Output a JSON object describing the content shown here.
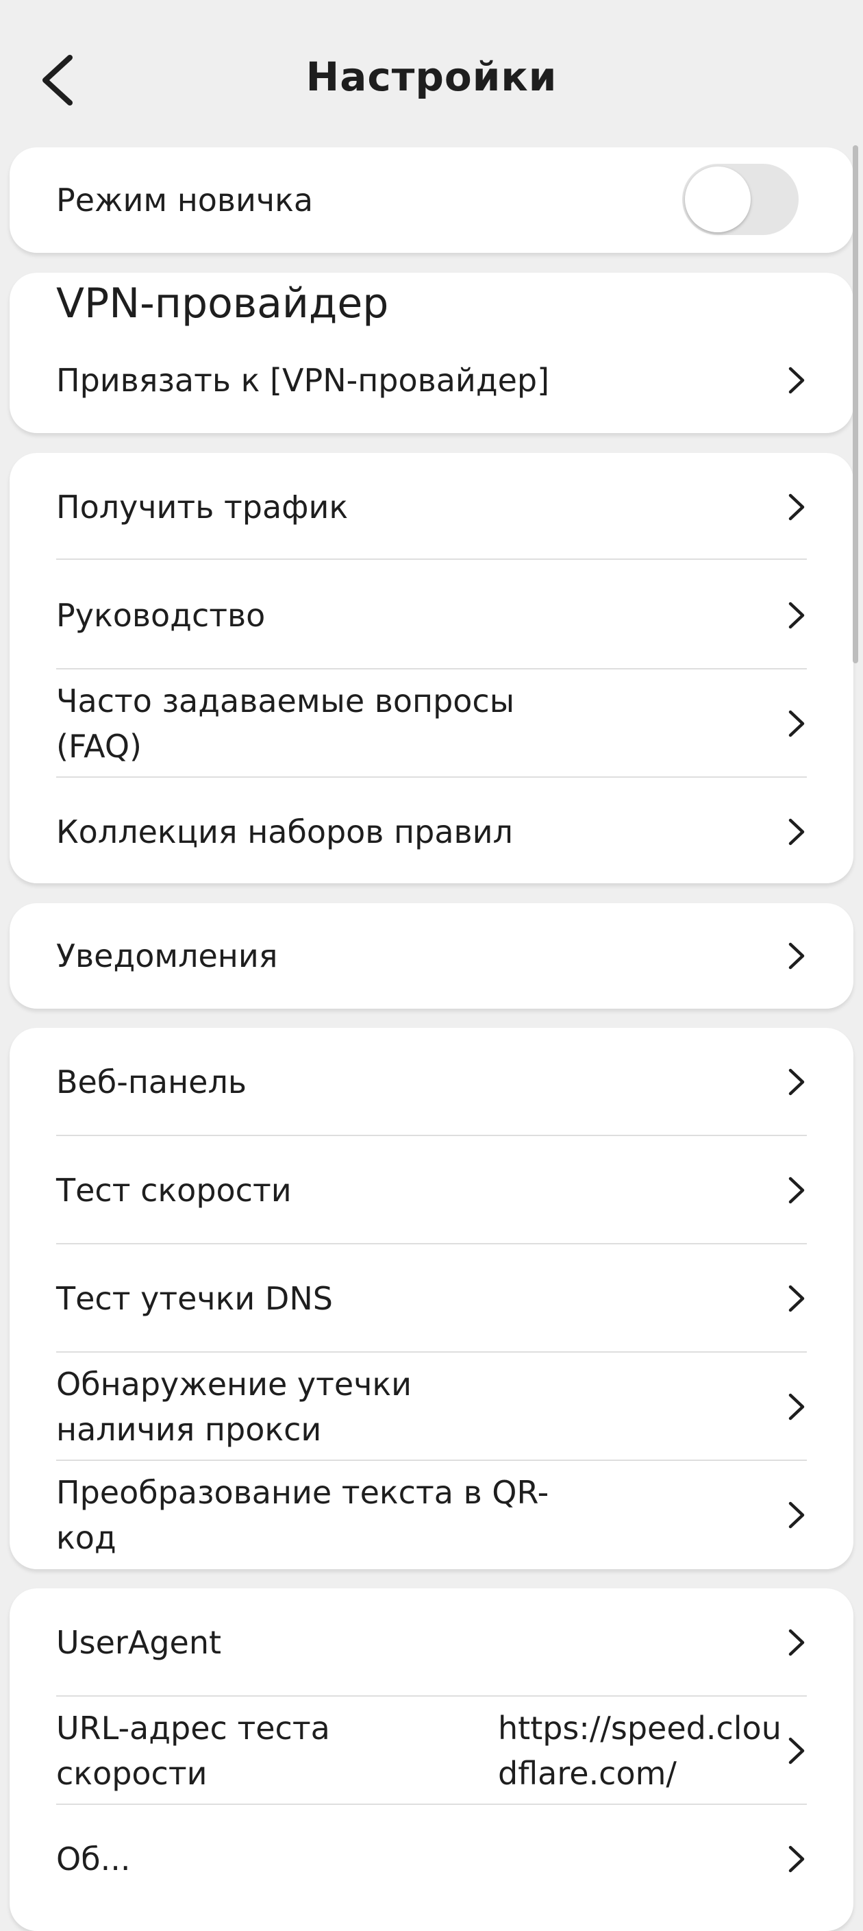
{
  "header": {
    "title": "Настройки"
  },
  "novice": {
    "label": "Режим новичка",
    "enabled": false
  },
  "vpn": {
    "heading": "VPN-провайдер",
    "bind_label": "Привязать к [VPN-провайдер]"
  },
  "group1": [
    {
      "label": "Получить трафик"
    },
    {
      "label": "Руководство"
    },
    {
      "label": "Часто задаваемые вопросы (FAQ)"
    },
    {
      "label": "Коллекция наборов правил"
    }
  ],
  "group2": [
    {
      "label": "Уведомления"
    }
  ],
  "group3": [
    {
      "label": "Веб-панель"
    },
    {
      "label": "Тест скорости"
    },
    {
      "label": "Тест утечки DNS"
    },
    {
      "label": "Обнаружение утечки наличия прокси"
    },
    {
      "label": "Преобразование текста в QR-код"
    }
  ],
  "group4": [
    {
      "label": "UserAgent"
    },
    {
      "label": "URL-адрес теста скорости",
      "value": "https://speed.cloudflare.com/"
    },
    {
      "label": "Об..."
    }
  ],
  "icons": {
    "back": "chevron-left-icon",
    "row": "chevron-right-icon"
  }
}
